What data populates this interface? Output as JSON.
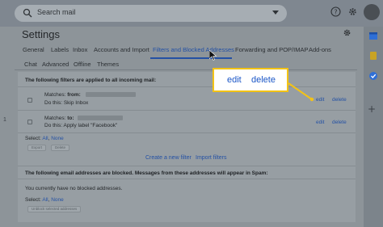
{
  "search": {
    "placeholder": "Search mail"
  },
  "page": {
    "title": "Settings"
  },
  "tabs": [
    {
      "label": "General"
    },
    {
      "label": "Labels"
    },
    {
      "label": "Inbox"
    },
    {
      "label": "Accounts and Import"
    },
    {
      "label": "Filters and Blocked Addresses",
      "active": true
    },
    {
      "label": "Forwarding and POP/IMAP"
    },
    {
      "label": "Add-ons"
    },
    {
      "label": "Chat"
    },
    {
      "label": "Advanced"
    },
    {
      "label": "Offline"
    },
    {
      "label": "Themes"
    }
  ],
  "filters": {
    "heading": "The following filters are applied to all incoming mail:",
    "items": [
      {
        "matches_prefix": "Matches: ",
        "matches_key": "from:",
        "action": "Do this: Skip Inbox",
        "edit": "edit",
        "delete": "delete"
      },
      {
        "matches_prefix": "Matches: ",
        "matches_key": "to:",
        "action": "Do this: Apply label \"Facebook\"",
        "edit": "edit",
        "delete": "delete"
      }
    ],
    "select_label": "Select: ",
    "select_all": "All",
    "select_none": "None",
    "export_button": "Export",
    "delete_button": "Delete",
    "create_filter": "Create a new filter",
    "import_filters": "Import filters"
  },
  "blocked": {
    "heading": "The following email addresses are blocked. Messages from these addresses will appear in Spam:",
    "empty_text": "You currently have no blocked addresses.",
    "select_label": "Select: ",
    "select_all": "All",
    "select_none": "None",
    "unblock_button": "Unblock selected addresses"
  },
  "callout": {
    "edit": "edit",
    "delete": "delete"
  },
  "left_marker": "1",
  "colors": {
    "accent": "#2451a4",
    "callout_border": "#f3c316",
    "callout_text": "#1a56c7"
  }
}
